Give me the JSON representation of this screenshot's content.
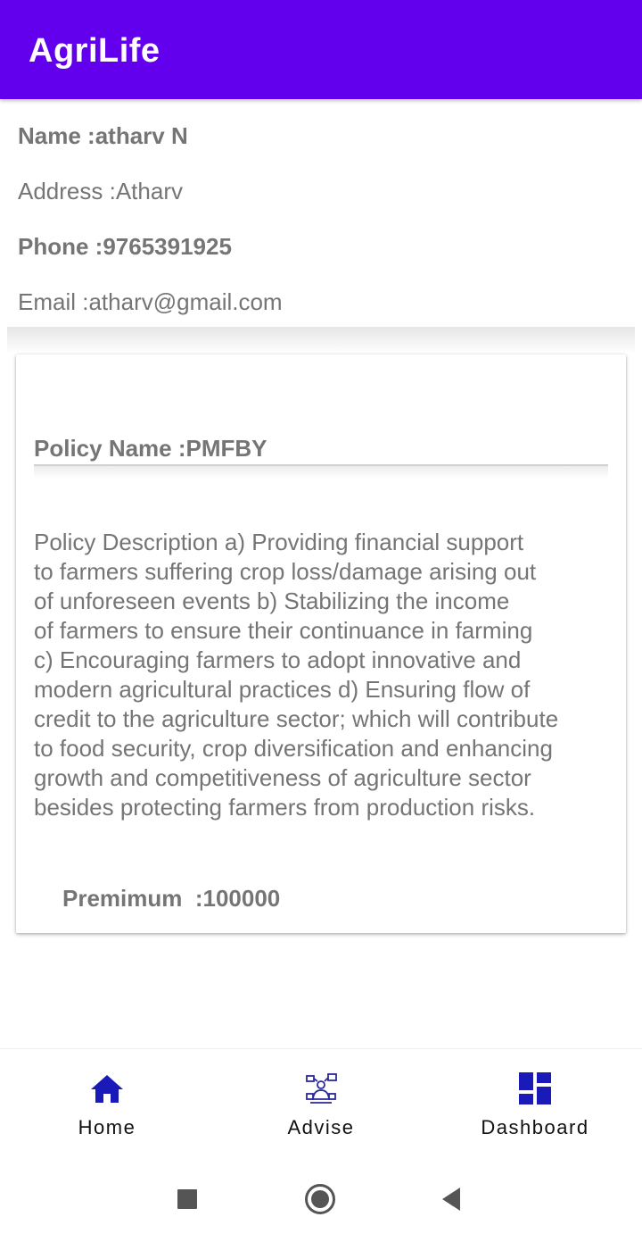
{
  "app": {
    "title": "AgriLife"
  },
  "user": {
    "name": "Name :atharv N",
    "address": "Address :Atharv",
    "phone": "Phone :9765391925",
    "email": "Email :atharv@gmail.com"
  },
  "policy": {
    "name": "Policy Name :PMFBY",
    "description": "Policy Description a) Providing financial support\nto farmers suffering crop loss/damage arising out\nof unforeseen events  b) Stabilizing the income\nof farmers to ensure their continuance in farming\nc) Encouraging farmers to adopt innovative and\nmodern agricultural practices  d) Ensuring flow of\ncredit to the agriculture sector; which will contribute\nto food security, crop diversification and enhancing\ngrowth and competitiveness of  agriculture sector\nbesides protecting farmers from production risks.",
    "premium": "Premimum  :100000"
  },
  "bottom_nav": {
    "items": [
      {
        "label": "Home",
        "icon": "home-icon"
      },
      {
        "label": "Advise",
        "icon": "advise-icon"
      },
      {
        "label": "Dashboard",
        "icon": "dashboard-icon"
      }
    ]
  },
  "system_nav": {
    "icons": [
      "recents-square-icon",
      "home-circle-icon",
      "back-triangle-icon"
    ]
  },
  "colors": {
    "app_bar": "#6200ee",
    "nav_icon": "#1a1ab8",
    "text": "#757575"
  }
}
